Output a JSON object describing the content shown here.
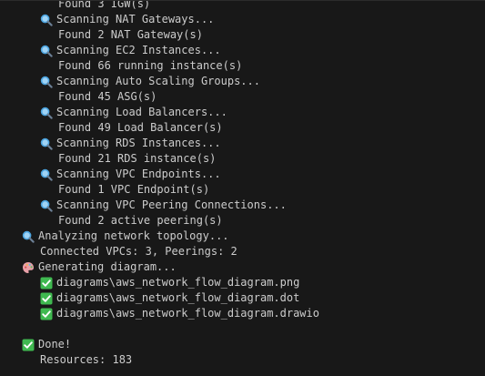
{
  "terminal": {
    "lines": [
      {
        "indent": 2,
        "icon": null,
        "text": "Found 3 IGW(s)"
      },
      {
        "indent": 1,
        "icon": "search-icon",
        "text": "Scanning NAT Gateways..."
      },
      {
        "indent": 2,
        "icon": null,
        "text": "Found 2 NAT Gateway(s)"
      },
      {
        "indent": 1,
        "icon": "search-icon",
        "text": "Scanning EC2 Instances..."
      },
      {
        "indent": 2,
        "icon": null,
        "text": "Found 66 running instance(s)"
      },
      {
        "indent": 1,
        "icon": "search-icon",
        "text": "Scanning Auto Scaling Groups..."
      },
      {
        "indent": 2,
        "icon": null,
        "text": "Found 45 ASG(s)"
      },
      {
        "indent": 1,
        "icon": "search-icon",
        "text": "Scanning Load Balancers..."
      },
      {
        "indent": 2,
        "icon": null,
        "text": "Found 49 Load Balancer(s)"
      },
      {
        "indent": 1,
        "icon": "search-icon",
        "text": "Scanning RDS Instances..."
      },
      {
        "indent": 2,
        "icon": null,
        "text": "Found 21 RDS instance(s)"
      },
      {
        "indent": 1,
        "icon": "search-icon",
        "text": "Scanning VPC Endpoints..."
      },
      {
        "indent": 2,
        "icon": null,
        "text": "Found 1 VPC Endpoint(s)"
      },
      {
        "indent": 1,
        "icon": "search-icon",
        "text": "Scanning VPC Peering Connections..."
      },
      {
        "indent": 2,
        "icon": null,
        "text": "Found 2 active peering(s)"
      },
      {
        "indent": 0,
        "icon": "search-icon",
        "text": "Analyzing network topology..."
      },
      {
        "indent": 1,
        "icon": null,
        "text": "Connected VPCs: 3, Peerings: 2"
      },
      {
        "indent": 0,
        "icon": "palette-icon",
        "text": "Generating diagram..."
      },
      {
        "indent": 1,
        "icon": "check-mark-icon",
        "text": "diagrams\\aws_network_flow_diagram.png"
      },
      {
        "indent": 1,
        "icon": "check-mark-icon",
        "text": "diagrams\\aws_network_flow_diagram.dot"
      },
      {
        "indent": 1,
        "icon": "check-mark-icon",
        "text": "diagrams\\aws_network_flow_diagram.drawio"
      },
      {
        "indent": 0,
        "icon": null,
        "text": ""
      },
      {
        "indent": 0,
        "icon": "check-mark-icon",
        "text": "Done!"
      },
      {
        "indent": 1,
        "icon": null,
        "text": "Resources: 183"
      }
    ]
  },
  "colors": {
    "background": "#181818",
    "text": "#cccccc",
    "search_icon": "#4aa3df",
    "check_icon": "#3fb950",
    "palette_icon": "#e8a0a8"
  }
}
